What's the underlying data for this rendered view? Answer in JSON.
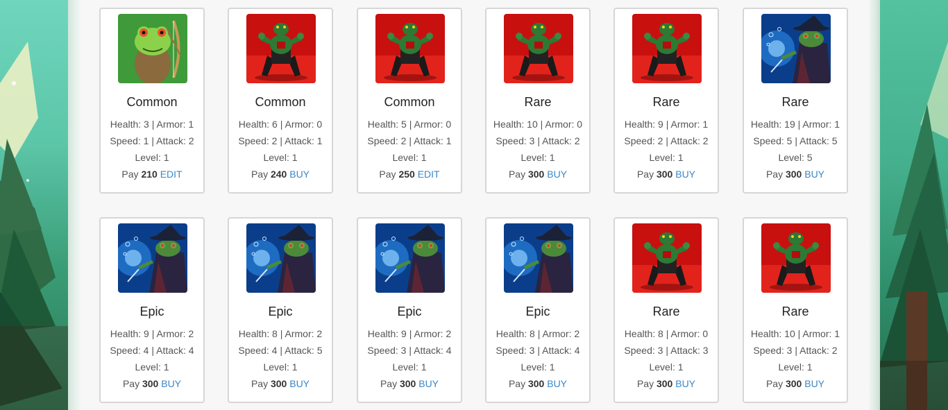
{
  "labels": {
    "health": "Health:",
    "armor": "Armor:",
    "speed": "Speed:",
    "attack": "Attack:",
    "level": "Level:",
    "pay": "Pay"
  },
  "colors": {
    "action_link": "#3a87c8",
    "card_border": "#d6d6d6",
    "rarity_text": "#222222"
  },
  "cards": [
    {
      "art": "archer-frog-icon",
      "rarity": "Common",
      "health": "3",
      "armor": "1",
      "speed": "1",
      "attack": "2",
      "level": "1",
      "price": "210",
      "action": "EDIT"
    },
    {
      "art": "fighter-frog-icon",
      "rarity": "Common",
      "health": "6",
      "armor": "0",
      "speed": "2",
      "attack": "1",
      "level": "1",
      "price": "240",
      "action": "BUY"
    },
    {
      "art": "fighter-frog-icon",
      "rarity": "Common",
      "health": "5",
      "armor": "0",
      "speed": "2",
      "attack": "1",
      "level": "1",
      "price": "250",
      "action": "EDIT"
    },
    {
      "art": "fighter-frog-icon",
      "rarity": "Rare",
      "health": "10",
      "armor": "0",
      "speed": "3",
      "attack": "2",
      "level": "1",
      "price": "300",
      "action": "BUY"
    },
    {
      "art": "fighter-frog-icon",
      "rarity": "Rare",
      "health": "9",
      "armor": "1",
      "speed": "2",
      "attack": "2",
      "level": "1",
      "price": "300",
      "action": "BUY"
    },
    {
      "art": "wizard-frog-icon",
      "rarity": "Rare",
      "health": "19",
      "armor": "1",
      "speed": "5",
      "attack": "5",
      "level": "5",
      "price": "300",
      "action": "BUY"
    },
    {
      "art": "wizard-frog-icon",
      "rarity": "Epic",
      "health": "9",
      "armor": "2",
      "speed": "4",
      "attack": "4",
      "level": "1",
      "price": "300",
      "action": "BUY"
    },
    {
      "art": "wizard-frog-icon",
      "rarity": "Epic",
      "health": "8",
      "armor": "2",
      "speed": "4",
      "attack": "5",
      "level": "1",
      "price": "300",
      "action": "BUY"
    },
    {
      "art": "wizard-frog-icon",
      "rarity": "Epic",
      "health": "9",
      "armor": "2",
      "speed": "3",
      "attack": "4",
      "level": "1",
      "price": "300",
      "action": "BUY"
    },
    {
      "art": "wizard-frog-icon",
      "rarity": "Epic",
      "health": "8",
      "armor": "2",
      "speed": "3",
      "attack": "4",
      "level": "1",
      "price": "300",
      "action": "BUY"
    },
    {
      "art": "fighter-frog-icon",
      "rarity": "Rare",
      "health": "8",
      "armor": "0",
      "speed": "3",
      "attack": "3",
      "level": "1",
      "price": "300",
      "action": "BUY"
    },
    {
      "art": "fighter-frog-icon",
      "rarity": "Rare",
      "health": "10",
      "armor": "1",
      "speed": "3",
      "attack": "2",
      "level": "1",
      "price": "300",
      "action": "BUY"
    }
  ]
}
